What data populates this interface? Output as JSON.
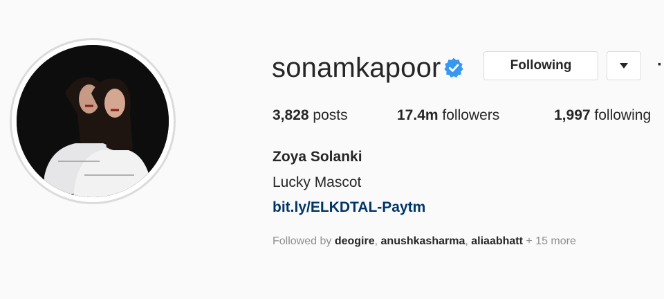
{
  "profile": {
    "username": "sonamkapoor",
    "verified_icon": "verified-badge-icon",
    "following_label": "Following",
    "dropdown_icon": "caret-down-icon",
    "more_label": "···"
  },
  "stats": {
    "posts_count": "3,828",
    "posts_label": "posts",
    "followers_count": "17.4m",
    "followers_label": "followers",
    "following_count": "1,997",
    "following_label": "following"
  },
  "bio": {
    "full_name": "Zoya Solanki",
    "text": "Lucky Mascot",
    "link": "bit.ly/ELKDTAL-Paytm"
  },
  "followed_by": {
    "prefix": "Followed by",
    "users": [
      "deogire",
      "anushkasharma",
      "aliaabhatt"
    ],
    "separator": ", ",
    "more": "+ 15 more"
  },
  "colors": {
    "background": "#fafafa",
    "verified": "#3897f0",
    "link": "#003569",
    "muted": "#8e8e8e",
    "border": "#dbdbdb"
  }
}
